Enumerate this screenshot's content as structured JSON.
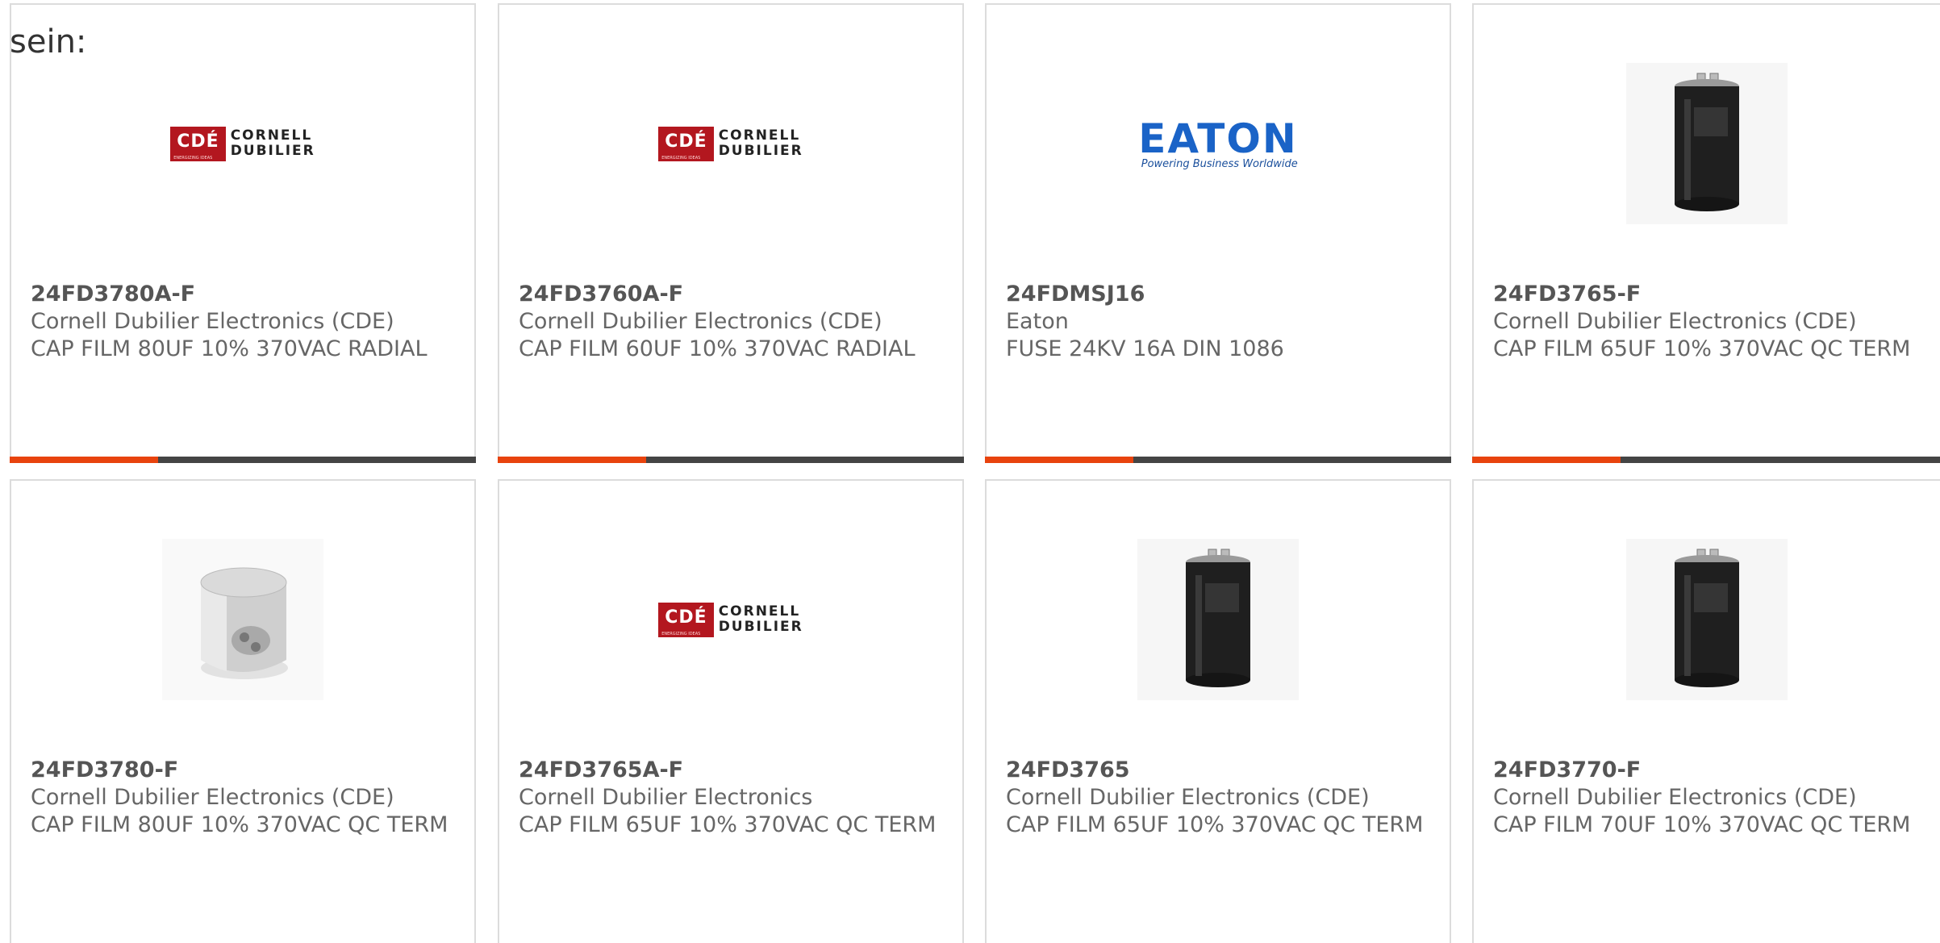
{
  "intro_text": "sein:",
  "colors": {
    "accent": "#e8430e",
    "bar": "#444444",
    "cde_red": "#b3171f",
    "eaton_blue": "#1a63c7"
  },
  "logos": {
    "cde": {
      "badge": "CDÉ",
      "tagline": "ENERGIZING IDEAS",
      "line1": "CORNELL",
      "line2": "DUBILIER"
    },
    "eaton": {
      "word": "EATON",
      "tagline": "Powering Business Worldwide"
    }
  },
  "products": [
    {
      "part": "24FD3780A-F",
      "manufacturer": "Cornell Dubilier Electronics (CDE)",
      "description": "CAP FILM 80UF 10% 370VAC RADIAL",
      "image": "cde-logo"
    },
    {
      "part": "24FD3760A-F",
      "manufacturer": "Cornell Dubilier Electronics (CDE)",
      "description": "CAP FILM 60UF 10% 370VAC RADIAL",
      "image": "cde-logo"
    },
    {
      "part": "24FDMSJ16",
      "manufacturer": "Eaton",
      "description": "FUSE 24KV 16A DIN 1086",
      "image": "eaton-logo"
    },
    {
      "part": "24FD3765-F",
      "manufacturer": "Cornell Dubilier Electronics (CDE)",
      "description": "CAP FILM 65UF 10% 370VAC QC TERM",
      "image": "black-capacitor"
    },
    {
      "part": "24FD3780-F",
      "manufacturer": "Cornell Dubilier Electronics (CDE)",
      "description": "CAP FILM 80UF 10% 370VAC QC TERM",
      "image": "silver-capacitor"
    },
    {
      "part": "24FD3765A-F",
      "manufacturer": "Cornell Dubilier Electronics",
      "description": "CAP FILM 65UF 10% 370VAC QC TERM",
      "image": "cde-logo"
    },
    {
      "part": "24FD3765",
      "manufacturer": "Cornell Dubilier Electronics (CDE)",
      "description": "CAP FILM 65UF 10% 370VAC QC TERM",
      "image": "black-capacitor"
    },
    {
      "part": "24FD3770-F",
      "manufacturer": "Cornell Dubilier Electronics (CDE)",
      "description": "CAP FILM 70UF 10% 370VAC QC TERM",
      "image": "black-capacitor"
    }
  ]
}
